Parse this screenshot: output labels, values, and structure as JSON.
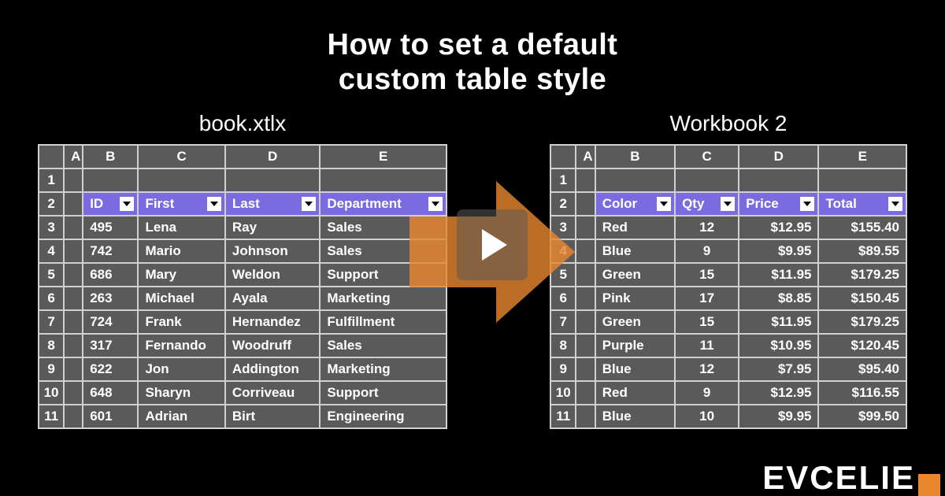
{
  "title": "How to set a default\ncustom table style",
  "left": {
    "filename": "book.xtlx",
    "col_letters": [
      "A",
      "B",
      "C",
      "D",
      "E"
    ],
    "row_numbers": [
      "1",
      "2",
      "3",
      "4",
      "5",
      "6",
      "7",
      "8",
      "9",
      "10",
      "11"
    ],
    "headers": [
      "ID",
      "First",
      "Last",
      "Department"
    ],
    "rows": [
      [
        "495",
        "Lena",
        "Ray",
        "Sales"
      ],
      [
        "742",
        "Mario",
        "Johnson",
        "Sales"
      ],
      [
        "686",
        "Mary",
        "Weldon",
        "Support"
      ],
      [
        "263",
        "Michael",
        "Ayala",
        "Marketing"
      ],
      [
        "724",
        "Frank",
        "Hernandez",
        "Fulfillment"
      ],
      [
        "317",
        "Fernando",
        "Woodruff",
        "Sales"
      ],
      [
        "622",
        "Jon",
        "Addington",
        "Marketing"
      ],
      [
        "648",
        "Sharyn",
        "Corriveau",
        "Support"
      ],
      [
        "601",
        "Adrian",
        "Birt",
        "Engineering"
      ]
    ]
  },
  "right": {
    "filename": "Workbook 2",
    "col_letters": [
      "A",
      "B",
      "C",
      "D",
      "E"
    ],
    "row_numbers": [
      "1",
      "2",
      "3",
      "4",
      "5",
      "6",
      "7",
      "8",
      "9",
      "10",
      "11"
    ],
    "headers": [
      "Color",
      "Qty",
      "Price",
      "Total"
    ],
    "rows": [
      [
        "Red",
        "12",
        "$12.95",
        "$155.40"
      ],
      [
        "Blue",
        "9",
        "$9.95",
        "$89.55"
      ],
      [
        "Green",
        "15",
        "$11.95",
        "$179.25"
      ],
      [
        "Pink",
        "17",
        "$8.85",
        "$150.45"
      ],
      [
        "Green",
        "15",
        "$11.95",
        "$179.25"
      ],
      [
        "Purple",
        "11",
        "$10.95",
        "$120.45"
      ],
      [
        "Blue",
        "12",
        "$7.95",
        "$95.40"
      ],
      [
        "Red",
        "9",
        "$12.95",
        "$116.55"
      ],
      [
        "Blue",
        "10",
        "$9.95",
        "$99.50"
      ]
    ]
  },
  "brand_fragment": "EVCELIE",
  "colors": {
    "header_bg": "#7a6be0",
    "grid": "#5a5a5a",
    "arrow": "#e9872f"
  }
}
